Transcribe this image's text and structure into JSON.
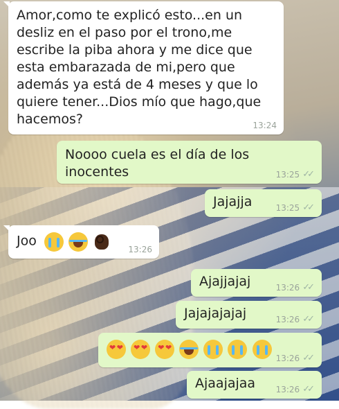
{
  "chat": {
    "messages": [
      {
        "dir": "in",
        "text": "Amor,como te explicó esto...en un\ndesliz en el paso por el trono,me\nescribe la piba ahora y me dice que\nesta embarazada de mi,pero que\nademás ya está de 4 meses y que lo\nquiere tener...Dios mío que hago,que\nhacemos?",
        "time": "13:24"
      },
      {
        "dir": "out",
        "text": "Noooo cuela es el día de los inocentes",
        "time": "13:25",
        "status": "read"
      },
      {
        "dir": "out",
        "text": "Jajajja",
        "time": "13:25",
        "status": "read"
      },
      {
        "dir": "in",
        "text": "Joo",
        "emojis": [
          "loudly-crying-face",
          "face-with-tears-of-joy",
          "ok-hand"
        ],
        "time": "13:26"
      },
      {
        "dir": "out",
        "text": "Ajajjajaj",
        "time": "13:26",
        "status": "read"
      },
      {
        "dir": "out",
        "text": "Jajajajajaj",
        "time": "13:26",
        "status": "read"
      },
      {
        "dir": "out",
        "text": "",
        "emojis": [
          "heart-eyes",
          "heart-eyes",
          "heart-eyes",
          "face-with-tears-of-joy",
          "loudly-crying-face",
          "loudly-crying-face",
          "loudly-crying-face"
        ],
        "time": "13:26",
        "status": "read"
      },
      {
        "dir": "out",
        "text": "Ajaajajaa",
        "time": "13:26",
        "status": "read"
      }
    ]
  },
  "colors": {
    "incoming": "#ffffff",
    "outgoing": "#e2f8c8",
    "meta": "#9aa39a"
  }
}
